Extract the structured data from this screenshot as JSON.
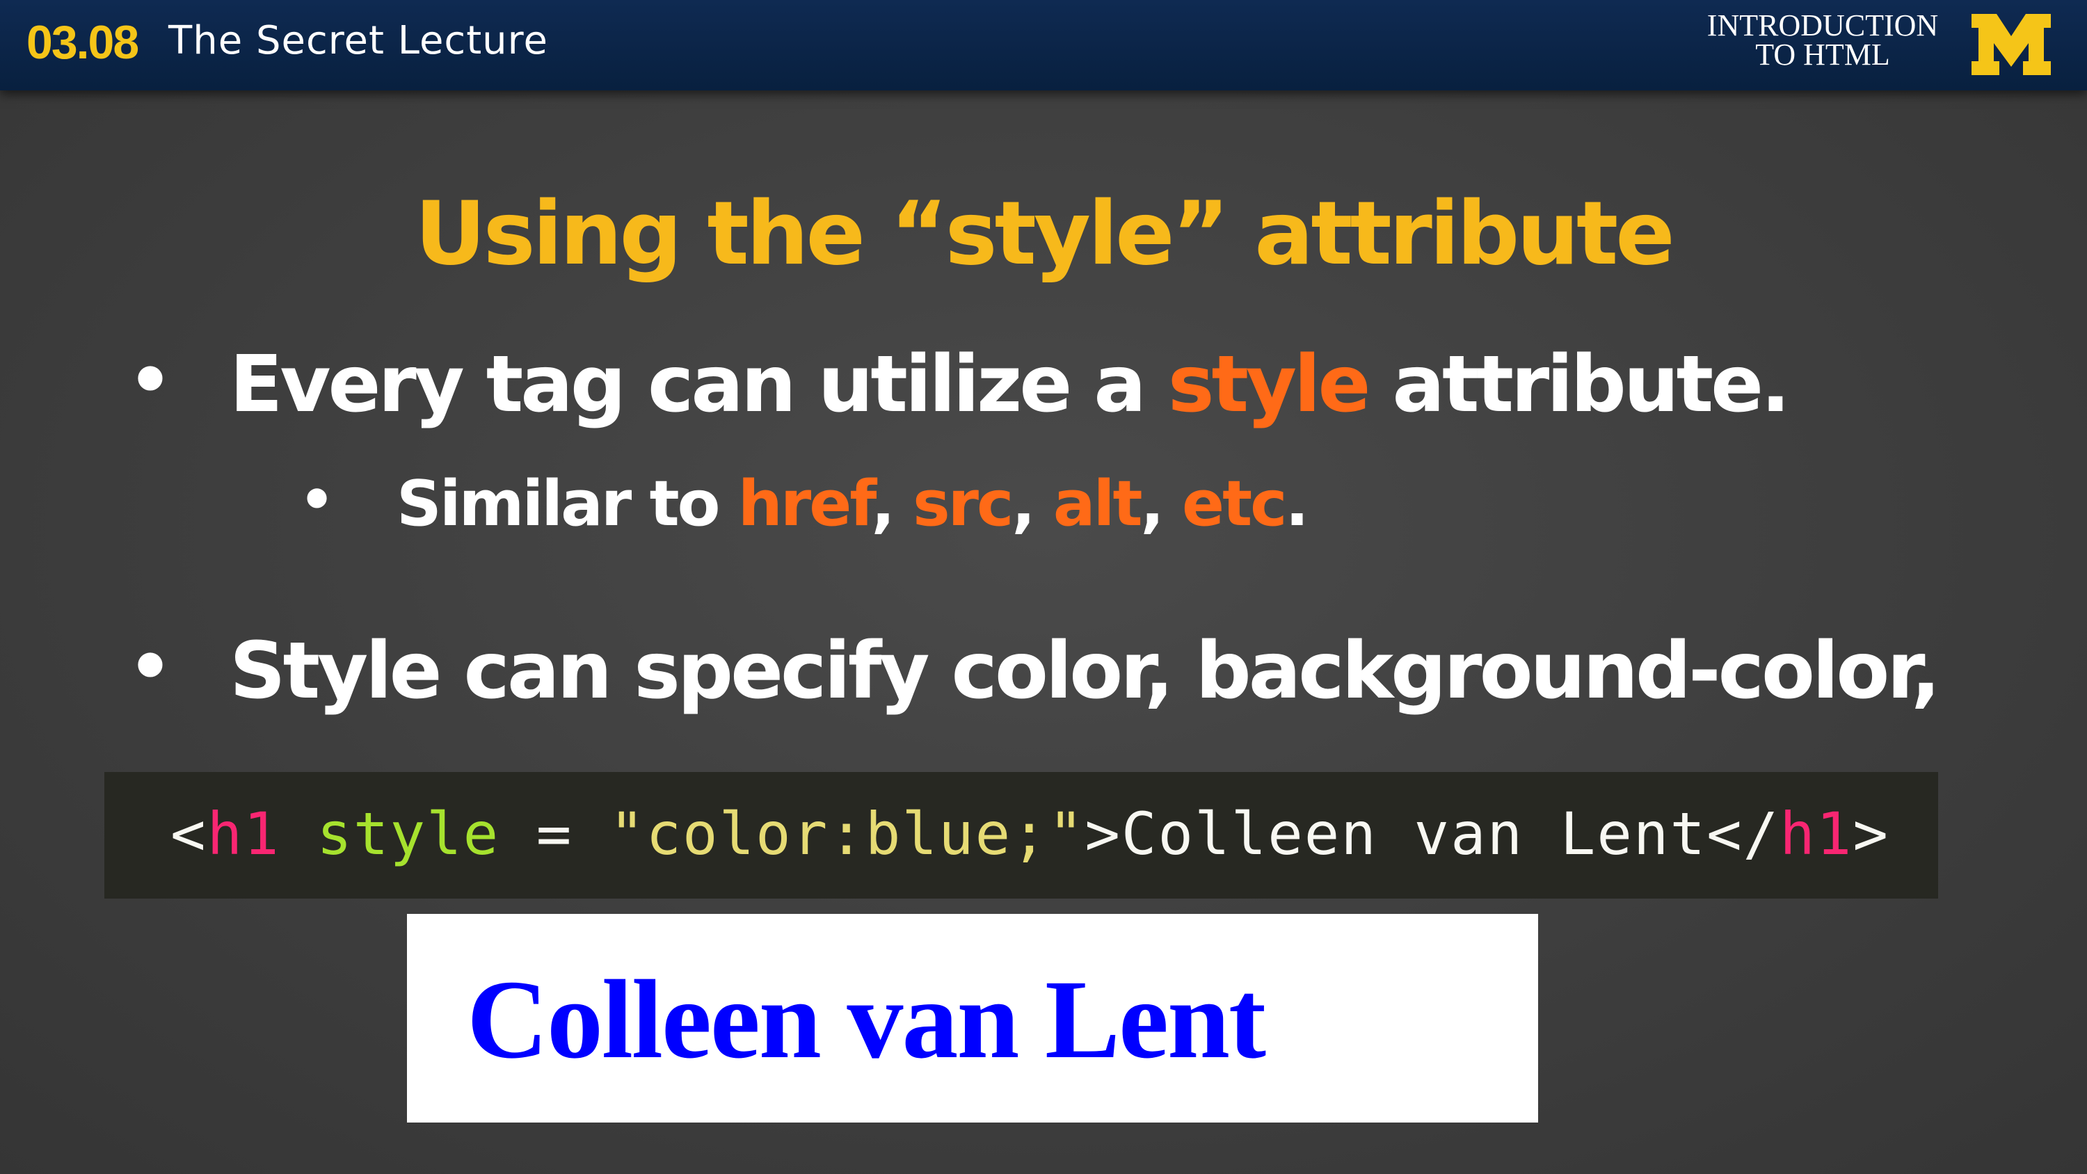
{
  "header": {
    "lecture_number": "03.08",
    "lecture_title": "The Secret Lecture",
    "course_line1": "INTRODUCTION",
    "course_line2": "TO HTML",
    "logo_letter": "M"
  },
  "slide": {
    "title": "Using the “style” attribute",
    "bullet1": {
      "marker": "•",
      "before": "Every tag can utilize a ",
      "highlight": "style",
      "after": " attribute."
    },
    "sub_bullet": {
      "marker": "•",
      "text_before": "Similar to ",
      "items": [
        "href",
        "src",
        "alt",
        "etc"
      ],
      "sep": ", ",
      "end": "."
    },
    "bullet2": {
      "marker": "•",
      "text": "Style can specify color, background-color,"
    }
  },
  "code": {
    "open_lt": "<",
    "open_tag": "h1",
    "attr": " style",
    "eq": " = ",
    "value": "\"color:blue;\"",
    "gt": ">",
    "content": "Colleen van Lent",
    "close_lt": "</",
    "close_tag": "h1",
    "close_gt": ">"
  },
  "preview": {
    "text": "Colleen van Lent",
    "color": "#0000ff"
  },
  "colors": {
    "header_bg": "#0f2a52",
    "accent_yellow": "#f7b91b",
    "highlight_orange": "#ff6a17",
    "code_bg": "#272822"
  }
}
